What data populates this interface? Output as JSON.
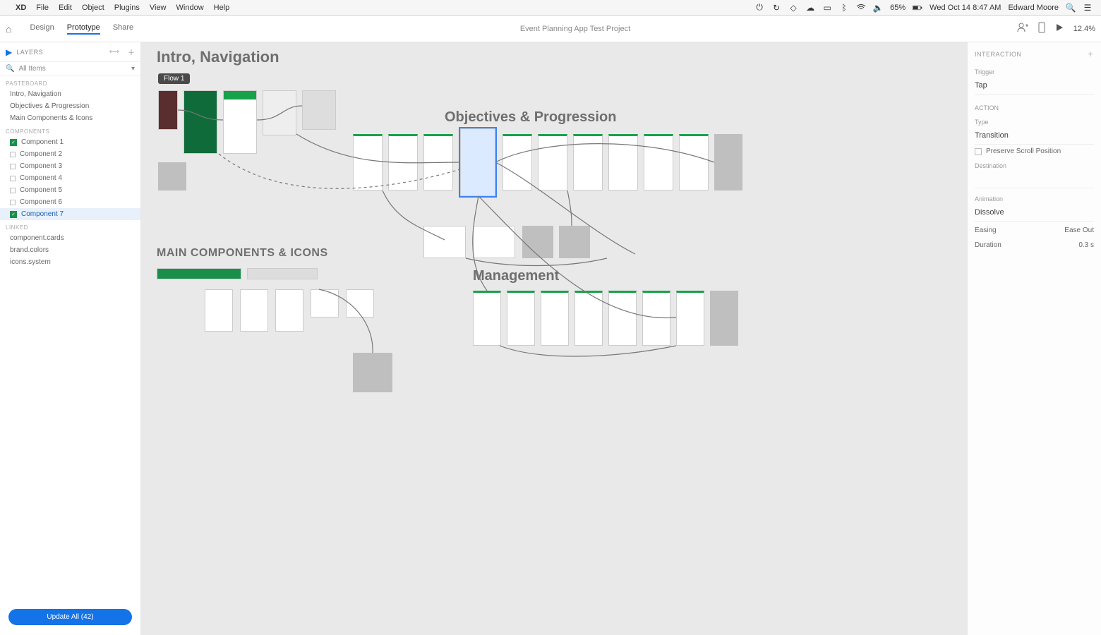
{
  "menubar": {
    "app": "XD",
    "items": [
      "File",
      "Edit",
      "Object",
      "Plugins",
      "View",
      "Window",
      "Help"
    ],
    "battery": "65%",
    "datetime": "Wed Oct 14  8:47 AM",
    "user": "Edward Moore"
  },
  "toolbar": {
    "tabs": {
      "design": "Design",
      "prototype": "Prototype",
      "share": "Share"
    },
    "doc_title": "Event Planning App Test Project",
    "zoom": "12.4%"
  },
  "left_panel": {
    "title": "Layers",
    "search": "All Items",
    "sections": {
      "pasteboard": {
        "label": "PASTEBOARD",
        "items": [
          "Intro, Navigation",
          "Objectives & Progression",
          "Main Components & Icons"
        ]
      },
      "components": {
        "label": "COMPONENTS",
        "items": [
          "Component 1",
          "Component 2",
          "Component 3",
          "Component 4",
          "Component 5",
          "Component 6",
          "Component 7"
        ]
      },
      "linked": {
        "label": "LINKED",
        "items": [
          "component.cards",
          "brand.colors",
          "icons.system"
        ]
      }
    },
    "button": "Update All (42)"
  },
  "canvas": {
    "sections": {
      "intro": "Intro, Navigation",
      "objectives": "Objectives & Progression",
      "main": "MAIN COMPONENTS & ICONS",
      "management": "Management"
    },
    "flow_label": "Flow 1"
  },
  "right_panel": {
    "header": "INTERACTION",
    "trigger_label": "Trigger",
    "trigger_value": "Tap",
    "action_label": "ACTION",
    "type_label": "Type",
    "type_value": "Transition",
    "preserve": "Preserve Scroll Position",
    "destination_label": "Destination",
    "animation_label": "Animation",
    "animation_value": "Dissolve",
    "easing_label": "Easing",
    "easing_value": "Ease Out",
    "duration_label": "Duration",
    "duration_value": "0.3 s"
  }
}
